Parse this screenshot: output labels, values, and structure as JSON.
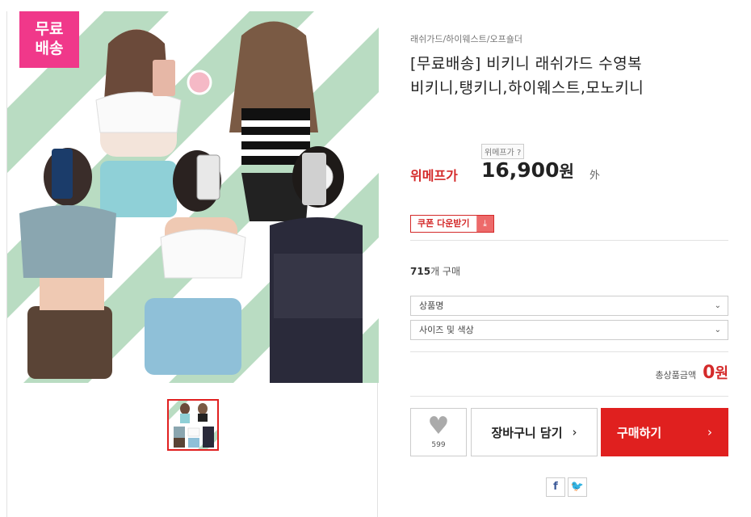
{
  "badge": {
    "line1": "무료",
    "line2": "배송"
  },
  "product": {
    "breadcrumb": "래쉬가드/하이웨스트/오프숄더",
    "title_line1": "[무료배송] 비키니 래쉬가드 수영복",
    "title_line2": "비키니,탱키니,하이웨스트,모노키니"
  },
  "price": {
    "label": "위메프가",
    "help": "위메프가 ?",
    "amount": "16,900",
    "unit": "원",
    "extra": "外"
  },
  "coupon": {
    "label": "쿠폰 다운받기",
    "icon": "⤓"
  },
  "buyers": {
    "count": "715",
    "suffix": "개 구매"
  },
  "options": [
    {
      "label": "상품명"
    },
    {
      "label": "사이즈 및 색상"
    }
  ],
  "total": {
    "label": "총상품금액",
    "value": "0",
    "unit": "원"
  },
  "actions": {
    "like_count": "599",
    "cart_label": "장바구니 담기",
    "buy_label": "구매하기"
  },
  "share": {
    "facebook": "f",
    "twitter": "🐦"
  },
  "colors": {
    "accent_red": "#e0201f",
    "badge_pink": "#f0388a",
    "stripe_green": "#b9dcc2"
  }
}
